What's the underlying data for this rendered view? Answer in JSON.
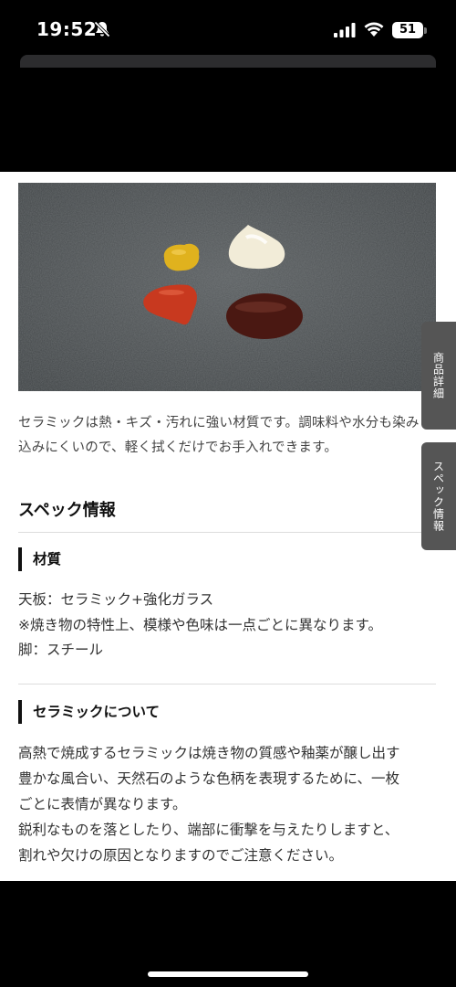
{
  "status_bar": {
    "time": "19:52",
    "battery": "51",
    "icons": [
      "bell-slash-icon",
      "signal-icon",
      "wifi-icon",
      "battery-icon"
    ]
  },
  "content": {
    "intro": "セラミックは熱・キズ・汚れに強い材質です。調味料や水分も染み込みにくいので、軽く拭くだけでお手入れできます。",
    "spec_title": "スペック情報",
    "material": {
      "heading": "材質",
      "lines": [
        "天板：セラミック+強化ガラス",
        "※焼き物の特性上、模様や色味は一点ごとに異なります。",
        "脚：スチール"
      ]
    },
    "ceramic": {
      "heading": "セラミックについて",
      "lines": [
        "高熱で焼成するセラミックは焼き物の質感や釉薬が醸し出す",
        "豊かな風合い、天然石のような色柄を表現するために、一枚",
        "ごとに表情が異なります。",
        "鋭利なものを落としたり、端部に衝撃を与えたりしますと、",
        "割れや欠けの原因となりますのでご注意ください。"
      ]
    }
  },
  "side_tabs": {
    "detail": "商品詳細",
    "spec": "スペック情報"
  },
  "colors": {
    "mustard": "#e0b21e",
    "mayo": "#f2ecd8",
    "ketchup": "#c8391f",
    "sauce": "#4a1812",
    "stone": "#4d5152",
    "tab": "#555555"
  }
}
